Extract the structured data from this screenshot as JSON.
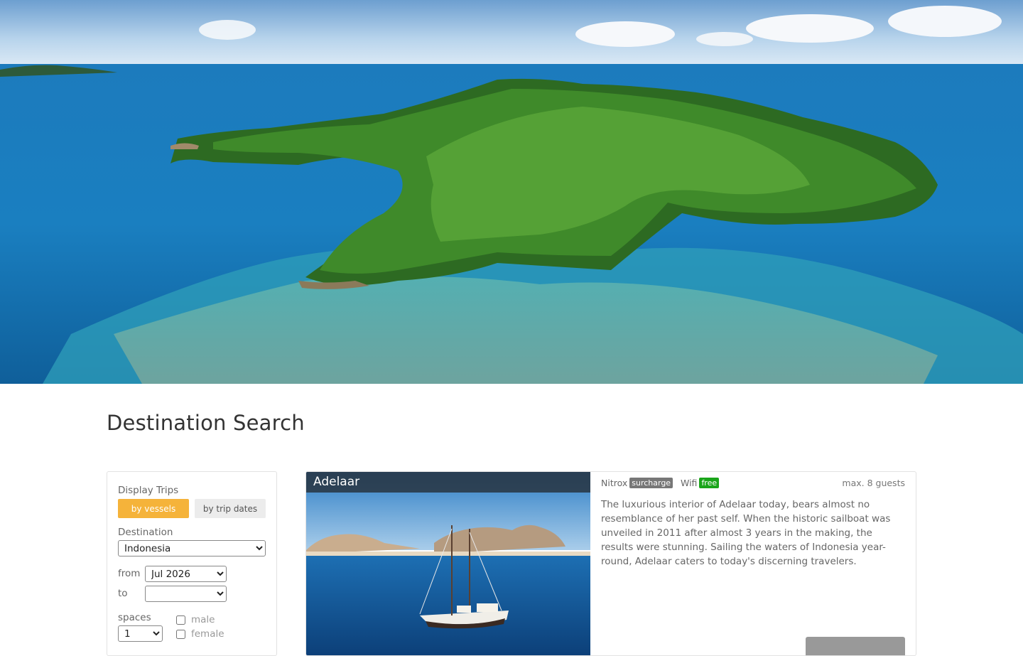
{
  "page": {
    "title": "Destination Search"
  },
  "filters": {
    "display_trips_label": "Display Trips",
    "by_vessels_label": "by vessels",
    "by_trip_dates_label": "by trip dates",
    "destination_label": "Destination",
    "destination_value": "Indonesia",
    "from_label": "from",
    "from_value": "Jul 2026",
    "to_label": "to",
    "to_value": "",
    "spaces_label": "spaces",
    "spaces_value": "1",
    "male_label": "male",
    "female_label": "female",
    "gender_icon_glyph": "",
    "accent_color": "#f5b33a"
  },
  "vessel": {
    "name": "Adelaar",
    "nitrox_label": "Nitrox",
    "nitrox_badge": "surcharge",
    "wifi_icon_glyph": "",
    "wifi_label": "Wifi",
    "wifi_badge": "free",
    "guests_icon_glyph": "",
    "guests_label": "max. 8 guests",
    "description": "The luxurious interior of Adelaar today, bears almost no resemblance of her past self. When the historic sailboat was unveiled in 2011 after almost 3 years in the making, the results were stunning. Sailing the waters of Indonesia year-round, Adelaar caters to today's discerning travelers."
  }
}
